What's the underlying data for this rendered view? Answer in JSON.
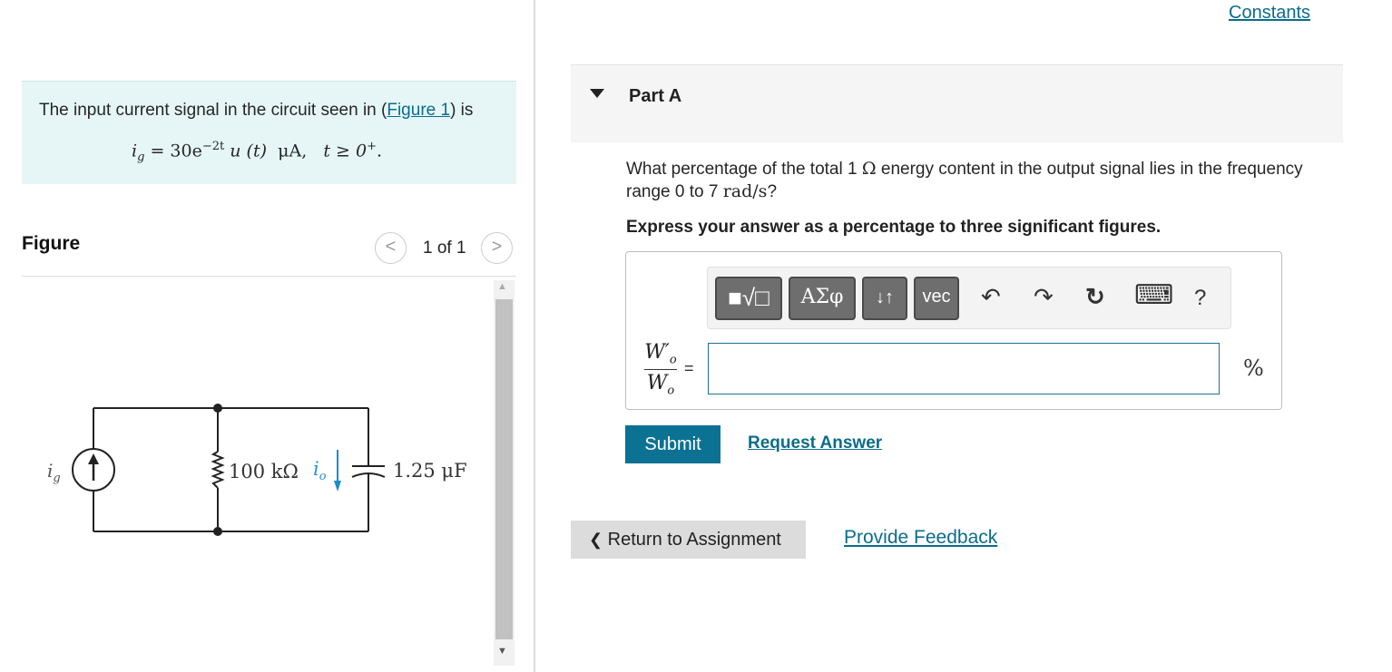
{
  "problem": {
    "intro_before": "The input current signal in the circuit seen in (",
    "figure_link": "Figure 1",
    "intro_after": ") is",
    "formula": {
      "lhs_var": "i",
      "lhs_sub": "g",
      "equals": "=",
      "coef": "30e",
      "exponent": "−2t",
      "func": "u (t)",
      "unit": "μA,",
      "condition": "t ≥ 0",
      "condition_sup": "+",
      "period": "."
    }
  },
  "figure": {
    "title": "Figure",
    "prev_icon": "<",
    "next_icon": ">",
    "page_count": "1 of 1",
    "circuit": {
      "source_label": "i",
      "source_sub": "g",
      "resistor_label": "100 kΩ",
      "current_label": "i",
      "current_sub": "o",
      "capacitor_label": "1.25 μF"
    }
  },
  "header": {
    "constants_link": "Constants"
  },
  "part_a": {
    "title": "Part A",
    "question_before": "What percentage of the total 1 ",
    "question_ohm": "Ω",
    "question_middle": " energy content in the output signal lies in the frequency range 0 to 7 ",
    "question_unit": "rad/s",
    "question_end": "?",
    "instruction": "Express your answer as a percentage to three significant figures.",
    "toolbar": {
      "templates": "■√□",
      "greek": "ΑΣφ",
      "arrows": "↓↑",
      "vec": "vec",
      "undo": "↶",
      "redo": "↷",
      "reset": "↻",
      "keyboard": "⌨",
      "help": "?"
    },
    "answer_lhs_num": "W′",
    "answer_lhs_num_sub": "o",
    "answer_lhs_den": "W",
    "answer_lhs_den_sub": "o",
    "equals": "=",
    "answer_value": "",
    "unit": "%",
    "submit": "Submit",
    "request_answer": "Request Answer"
  },
  "footer": {
    "return_label": "Return to Assignment",
    "return_icon": "❮",
    "feedback": "Provide Feedback"
  },
  "colors": {
    "accent": "#0b7294",
    "problem_bg": "#e6f6f7",
    "link": "#0b6c8c"
  }
}
